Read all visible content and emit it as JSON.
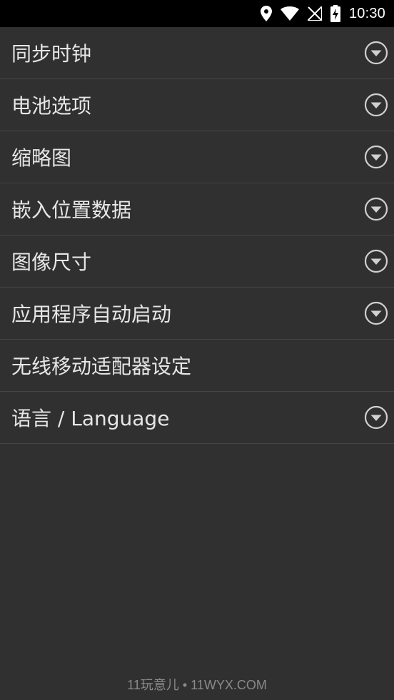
{
  "status_bar": {
    "time": "10:30",
    "icons": [
      "location-icon",
      "wifi-icon",
      "no-sim-icon",
      "battery-charging-icon"
    ]
  },
  "settings": {
    "items": [
      {
        "label": "同步时钟",
        "has_dropdown": true
      },
      {
        "label": "电池选项",
        "has_dropdown": true
      },
      {
        "label": "缩略图",
        "has_dropdown": true
      },
      {
        "label": "嵌入位置数据",
        "has_dropdown": true
      },
      {
        "label": "图像尺寸",
        "has_dropdown": true
      },
      {
        "label": "应用程序自动启动",
        "has_dropdown": true
      },
      {
        "label": "无线移动适配器设定",
        "has_dropdown": false
      },
      {
        "label": "语言 / Language",
        "has_dropdown": true
      }
    ]
  },
  "watermark": {
    "text": "11玩意儿 • 11WYX.COM"
  },
  "colors": {
    "background": "#303030",
    "status_bar": "#000000",
    "divider": "#454545",
    "text": "#e6e6e6",
    "icon": "#d0d0d0"
  }
}
